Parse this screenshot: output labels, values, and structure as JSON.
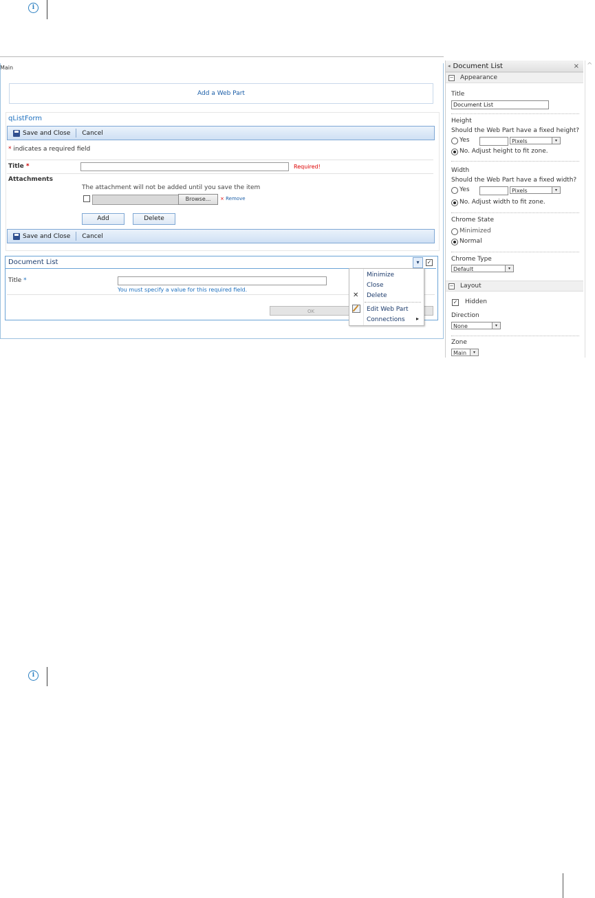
{
  "main": {
    "zone_label": "Main",
    "add_web_part": "Add a Web Part",
    "list_form_title": "qListForm",
    "toolbar": {
      "save_close": "Save and Close",
      "cancel": "Cancel"
    },
    "required_note": "indicates a required field",
    "required_star": "*",
    "title_label": "Title",
    "required_text": "Required!",
    "attachments_label": "Attachments",
    "attachment_note": "The attachment will not be added until you save the item",
    "browse": "Browse...",
    "remove": "Remove",
    "remove_x": "×",
    "add": "Add",
    "delete": "Delete"
  },
  "doc_list_part": {
    "title": "Document List",
    "field_label": "Title",
    "field_star": "*",
    "error": "You must specify a value for this required field.",
    "ok": "OK",
    "dropdown_arrow": "▾",
    "check": "✓"
  },
  "context_menu": {
    "items": [
      "Minimize",
      "Close",
      "Delete",
      "Edit Web Part",
      "Connections"
    ],
    "delete_x": "✕",
    "arrow": "▸"
  },
  "tool_pane": {
    "header": "Document List",
    "close": "×",
    "back_arrow": "◂",
    "appearance": "Appearance",
    "title_label": "Title",
    "title_value": "Document List",
    "height_label": "Height",
    "height_question": "Should the Web Part have a fixed height?",
    "yes": "Yes",
    "pixels": "Pixels",
    "height_no": "No. Adjust height to fit zone.",
    "width_label": "Width",
    "width_question": "Should the Web Part have a fixed width?",
    "width_no": "No. Adjust width to fit zone.",
    "chrome_state_label": "Chrome State",
    "minimized": "Minimized",
    "normal": "Normal",
    "chrome_type_label": "Chrome Type",
    "chrome_type_value": "Default",
    "layout": "Layout",
    "hidden": "Hidden",
    "direction_label": "Direction",
    "direction_value": "None",
    "zone_label": "Zone",
    "zone_value": "Main",
    "minus": "−",
    "arrow": "▾",
    "check": "✓",
    "scroll_caret": "^"
  },
  "icons": {
    "info": "i"
  }
}
